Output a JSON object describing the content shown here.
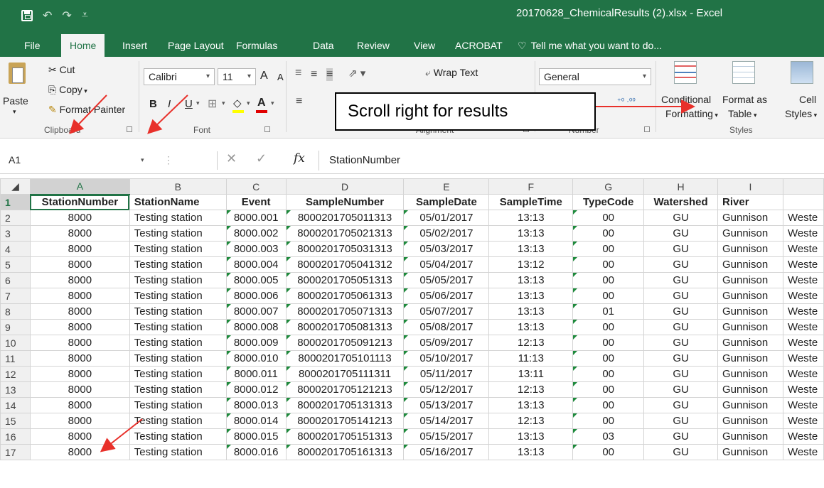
{
  "window": {
    "title": "20170628_ChemicalResults (2).xlsx - Excel"
  },
  "tabs": [
    "File",
    "Home",
    "Insert",
    "Page Layout",
    "Formulas",
    "Data",
    "Review",
    "View",
    "ACROBAT"
  ],
  "active_tab": "Home",
  "tell_me": "Tell me what you want to do...",
  "ribbon": {
    "clipboard": {
      "paste": "Paste",
      "cut": "Cut",
      "copy": "Copy",
      "format_painter": "Format Painter",
      "label": "Clipboard"
    },
    "font": {
      "name": "Calibri",
      "size": "11",
      "bold": "B",
      "italic": "I",
      "underline": "U",
      "grow": "A",
      "shrink": "A",
      "font_color": "A",
      "label": "Font"
    },
    "alignment": {
      "wrap_text": "Wrap Text",
      "label": "Alignment"
    },
    "number": {
      "format": "General",
      "label": "Number"
    },
    "styles": {
      "conditional_formatting": [
        "Conditional",
        "Formatting"
      ],
      "format_as_table": [
        "Format as",
        "Table"
      ],
      "cell_styles": [
        "Cell",
        "Styles"
      ],
      "label": "Styles"
    }
  },
  "callout": "Scroll right for results",
  "formula_bar": {
    "cell_ref": "A1",
    "fx": "fx",
    "content": "StationNumber"
  },
  "sheet": {
    "columns": [
      "A",
      "B",
      "C",
      "D",
      "E",
      "F",
      "G",
      "H",
      "I"
    ],
    "header_row": [
      "StationNumber",
      "StationName",
      "Event",
      "SampleNumber",
      "SampleDate",
      "SampleTime",
      "TypeCode",
      "Watershed",
      "River"
    ],
    "rows": [
      [
        "8000",
        "Testing station",
        "8000.001",
        "8000201705011313",
        "05/01/2017",
        "13:13",
        "00",
        "GU",
        "Gunnison",
        "Weste"
      ],
      [
        "8000",
        "Testing station",
        "8000.002",
        "8000201705021313",
        "05/02/2017",
        "13:13",
        "00",
        "GU",
        "Gunnison",
        "Weste"
      ],
      [
        "8000",
        "Testing station",
        "8000.003",
        "8000201705031313",
        "05/03/2017",
        "13:13",
        "00",
        "GU",
        "Gunnison",
        "Weste"
      ],
      [
        "8000",
        "Testing station",
        "8000.004",
        "8000201705041312",
        "05/04/2017",
        "13:12",
        "00",
        "GU",
        "Gunnison",
        "Weste"
      ],
      [
        "8000",
        "Testing station",
        "8000.005",
        "8000201705051313",
        "05/05/2017",
        "13:13",
        "00",
        "GU",
        "Gunnison",
        "Weste"
      ],
      [
        "8000",
        "Testing station",
        "8000.006",
        "8000201705061313",
        "05/06/2017",
        "13:13",
        "00",
        "GU",
        "Gunnison",
        "Weste"
      ],
      [
        "8000",
        "Testing station",
        "8000.007",
        "8000201705071313",
        "05/07/2017",
        "13:13",
        "01",
        "GU",
        "Gunnison",
        "Weste"
      ],
      [
        "8000",
        "Testing station",
        "8000.008",
        "8000201705081313",
        "05/08/2017",
        "13:13",
        "00",
        "GU",
        "Gunnison",
        "Weste"
      ],
      [
        "8000",
        "Testing station",
        "8000.009",
        "8000201705091213",
        "05/09/2017",
        "12:13",
        "00",
        "GU",
        "Gunnison",
        "Weste"
      ],
      [
        "8000",
        "Testing station",
        "8000.010",
        "8000201705101113",
        "05/10/2017",
        "11:13",
        "00",
        "GU",
        "Gunnison",
        "Weste"
      ],
      [
        "8000",
        "Testing station",
        "8000.011",
        "8000201705111311",
        "05/11/2017",
        "13:11",
        "00",
        "GU",
        "Gunnison",
        "Weste"
      ],
      [
        "8000",
        "Testing station",
        "8000.012",
        "8000201705121213",
        "05/12/2017",
        "12:13",
        "00",
        "GU",
        "Gunnison",
        "Weste"
      ],
      [
        "8000",
        "Testing station",
        "8000.013",
        "8000201705131313",
        "05/13/2017",
        "13:13",
        "00",
        "GU",
        "Gunnison",
        "Weste"
      ],
      [
        "8000",
        "Testing station",
        "8000.014",
        "8000201705141213",
        "05/14/2017",
        "12:13",
        "00",
        "GU",
        "Gunnison",
        "Weste"
      ],
      [
        "8000",
        "Testing station",
        "8000.015",
        "8000201705151313",
        "05/15/2017",
        "13:13",
        "03",
        "GU",
        "Gunnison",
        "Weste"
      ],
      [
        "8000",
        "Testing station",
        "8000.016",
        "8000201705161313",
        "05/16/2017",
        "13:13",
        "00",
        "GU",
        "Gunnison",
        "Weste"
      ]
    ]
  },
  "colors": {
    "excel_green": "#217346",
    "annotation_red": "#e8302a"
  }
}
